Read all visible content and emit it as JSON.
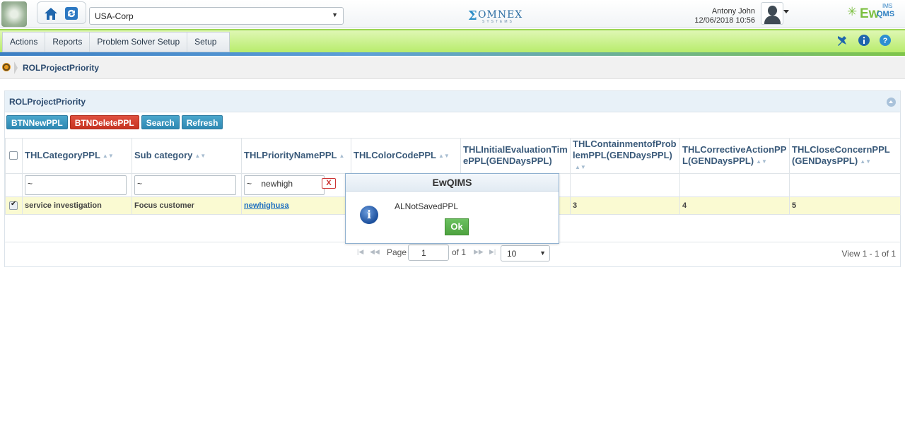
{
  "header": {
    "company": "USA-Corp",
    "omnex_logo_text": "OMNEX",
    "omnex_logo_sub": "SYSTEMS",
    "user_name": "Antony John",
    "datetime": "12/06/2018 10:56",
    "product_logo": "EwQIMS",
    "product_logo_main": "Ew",
    "product_logo_q": "QMS",
    "product_logo_ims": "IMS"
  },
  "menu": {
    "items": [
      "Actions",
      "Reports",
      "Problem Solver Setup",
      "Setup"
    ],
    "right_icons": [
      "pin-icon",
      "info-icon",
      "help-icon"
    ]
  },
  "breadcrumb": {
    "current": "ROLProjectPriority"
  },
  "panel": {
    "title": "ROLProjectPriority",
    "buttons": {
      "new": "BTNNewPPL",
      "delete": "BTNDeletePPL",
      "search": "Search",
      "refresh": "Refresh"
    }
  },
  "grid": {
    "columns": [
      "THLCategoryPPL",
      "Sub category",
      "THLPriorityNamePPL",
      "THLColorCodePPL",
      "THLInitialEvaluationTimePPL(GENDaysPPL)",
      "THLContainmentofProblemPPL(GENDaysPPL)",
      "THLCorrectiveActionPPL(GENDaysPPL)",
      "THLCloseConcernPPL(GENDaysPPL)"
    ],
    "filters": {
      "category": "~",
      "subcategory": "~",
      "priority_prefix": "~",
      "priority_value": "newhigh",
      "clear_label": "X"
    },
    "rows": [
      {
        "category": "service investigation",
        "subcategory": "Focus customer",
        "priority": "newhighusa",
        "color": "",
        "initial": "",
        "containment": "3",
        "corrective": "4",
        "close": "5"
      }
    ]
  },
  "pager": {
    "page_label": "Page",
    "page": "1",
    "of_label": "of 1",
    "page_size": "10",
    "view": "View 1 - 1 of 1"
  },
  "dialog": {
    "title": "EwQIMS",
    "message": "ALNotSavedPPL",
    "ok": "Ok"
  },
  "colors": {
    "menu_green": "#b8ec6c",
    "button_blue": "#2f89b3",
    "button_red": "#c63422",
    "ok_green": "#4ea23f",
    "row_highlight": "#fafad2"
  }
}
